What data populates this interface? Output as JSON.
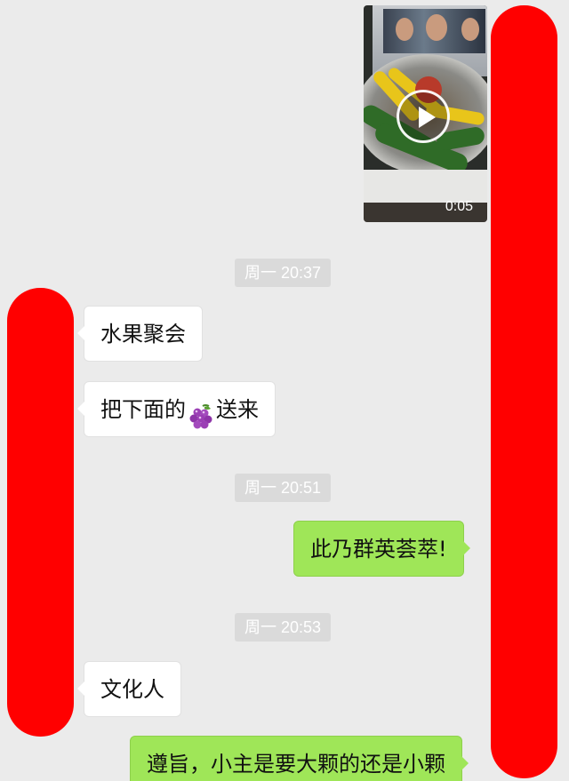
{
  "video_message": {
    "duration": "0:05"
  },
  "messages": [
    {
      "type": "timestamp",
      "text": "周一 20:37"
    },
    {
      "type": "incoming",
      "text": "水果聚会"
    },
    {
      "type": "incoming",
      "text_before": "把下面的",
      "icon": "grape-emoji",
      "text_after": "送来"
    },
    {
      "type": "timestamp",
      "text": "周一 20:51"
    },
    {
      "type": "outgoing",
      "text": "此乃群英荟萃!"
    },
    {
      "type": "timestamp",
      "text": "周一 20:53"
    },
    {
      "type": "incoming",
      "text": "文化人"
    },
    {
      "type": "outgoing",
      "text": "遵旨，小主是要大颗的还是小颗"
    }
  ],
  "colors": {
    "background": "#ebebeb",
    "outgoing_bubble": "#9fe658",
    "incoming_bubble": "#ffffff",
    "redaction": "#ff0000",
    "timestamp_bg": "#dadada"
  }
}
